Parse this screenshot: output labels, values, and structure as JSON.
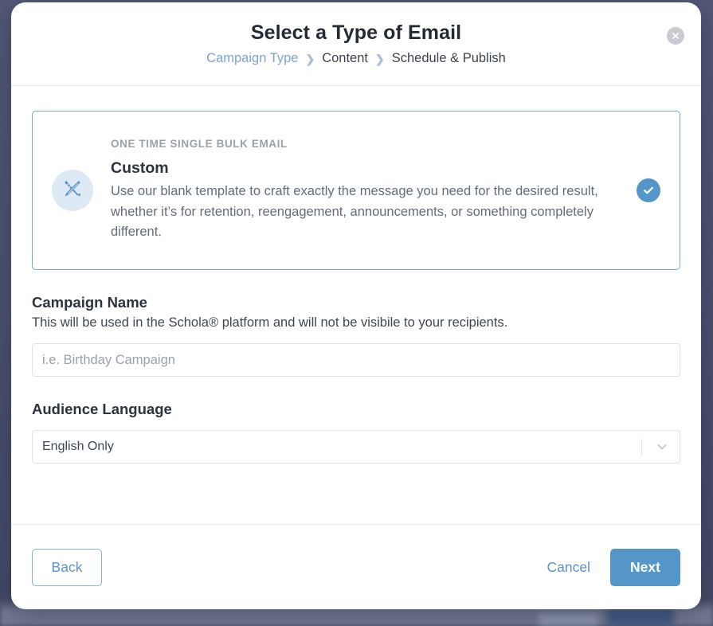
{
  "theme": {
    "backdrop": "#4a5070",
    "accent_blue": "#5596c8",
    "link_blue": "#5b94cb",
    "card_border": "#79a6cf",
    "icon_bubble": "#ddeaf5",
    "muted_text": "#9aa1ab",
    "close_circle": "#c8cbd2"
  },
  "header": {
    "title": "Select a Type of Email",
    "close_label": "Close",
    "breadcrumb": [
      {
        "label": "Campaign Type",
        "active": true
      },
      {
        "label": "Content",
        "active": false
      },
      {
        "label": "Schedule & Publish",
        "active": false
      }
    ],
    "breadcrumb_separator": "❯"
  },
  "type_card": {
    "eyebrow": "ONE TIME SINGLE BULK EMAIL",
    "name": "Custom",
    "description": "Use our blank template to craft exactly the message you need for the desired result, whether it’s for retention, reengagement, announcements, or something completely different.",
    "icon": "pencil-ruler-icon",
    "selected": true,
    "selected_icon": "check-circle-icon"
  },
  "form": {
    "campaign_name": {
      "label": "Campaign Name",
      "help": "This will be used in the Schola® platform and will not be visibile to your recipients.",
      "placeholder": "i.e. Birthday Campaign",
      "value": ""
    },
    "audience_language": {
      "label": "Audience Language",
      "selected": "English Only",
      "options": [
        "English Only"
      ],
      "caret_icon": "chevron-down-icon"
    }
  },
  "footer": {
    "back_label": "Back",
    "cancel_label": "Cancel",
    "next_label": "Next"
  }
}
